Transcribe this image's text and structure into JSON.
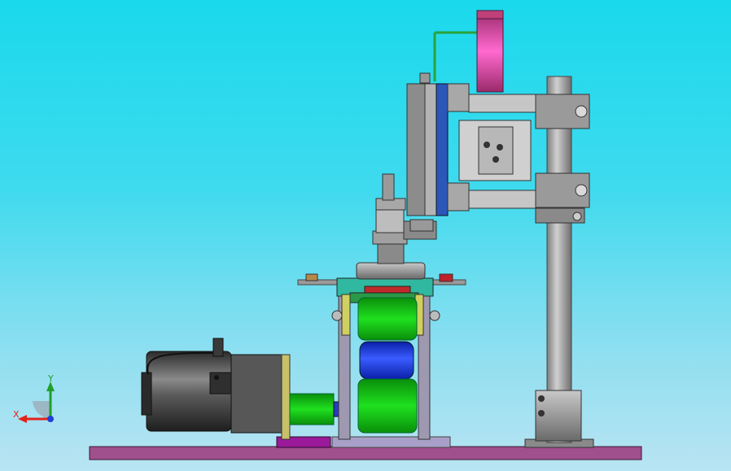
{
  "viewport": {
    "background_top": "#1ad9ec",
    "background_bottom": "#b9e4f3"
  },
  "triad": {
    "x_label": "X",
    "y_label": "Y",
    "x_color": "#e2231a",
    "y_color": "#1fa02a",
    "z_color": "#1f3fd8"
  },
  "model": {
    "parts": [
      "base-plate",
      "servo-motor",
      "coupling",
      "roller-frame",
      "green-roller-upper",
      "blue-roller",
      "green-roller-lower",
      "spring-tensioner",
      "vertical-post",
      "slide-carriage",
      "magenta-cylinder"
    ]
  }
}
